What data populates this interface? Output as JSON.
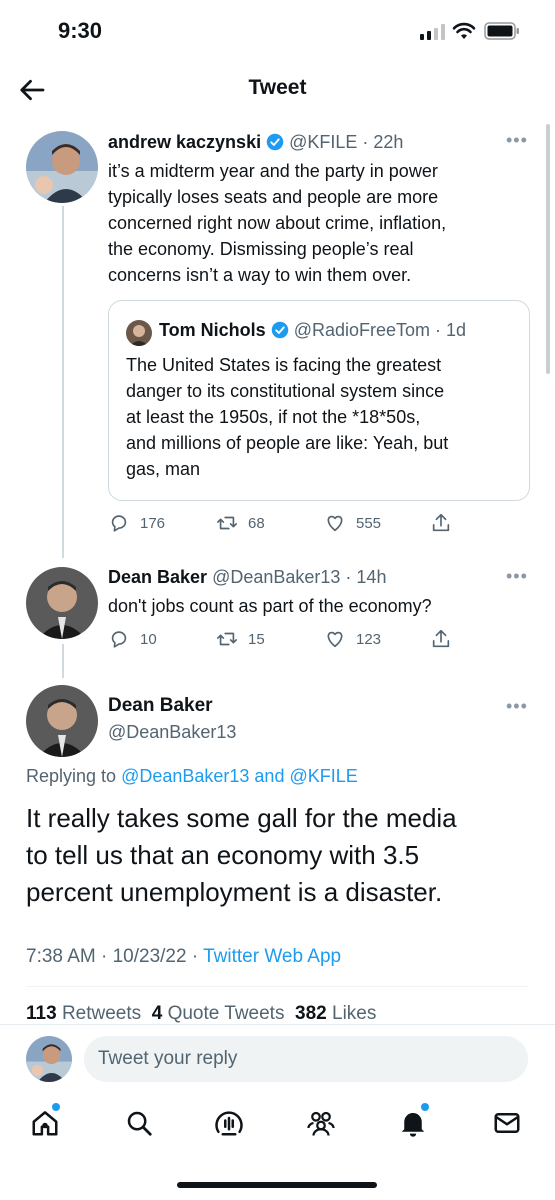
{
  "status_bar": {
    "time": "9:30"
  },
  "header": {
    "title": "Tweet"
  },
  "tweet1": {
    "name": "andrew kaczynski",
    "meta": "@KFILE · 22h",
    "lines": [
      "it’s a midterm year and the party in power",
      "typically loses seats and people are more",
      "concerned right now about crime, inflation,",
      "the economy. Dismissing people’s real",
      "concerns isn’t a way to win them over."
    ],
    "quote": {
      "name": "Tom Nichols",
      "meta": "@RadioFreeTom · 1d",
      "lines": [
        "The United States is facing the greatest",
        "danger to its constitutional system since",
        "at least the 1950s, if not the *18*50s,",
        "and millions of people are like: Yeah, but",
        "gas, man"
      ]
    },
    "replies": "176",
    "retweets": "68",
    "likes": "555"
  },
  "tweet2": {
    "name": "Dean Baker",
    "meta": "@DeanBaker13 · 14h",
    "text": "don't jobs count as part of the economy?",
    "replies": "10",
    "retweets": "15",
    "likes": "123"
  },
  "main": {
    "name": "Dean Baker",
    "handle": "@DeanBaker13",
    "replying_prefix": "Replying to",
    "replying_users": "@DeanBaker13 and @KFILE",
    "lines": [
      "It really takes some gall for the media",
      "to tell us that an economy with 3.5",
      "percent unemployment is a disaster."
    ],
    "timestamp": "7:38 AM · 10/23/22 ·",
    "source": "Twitter Web App",
    "retweets_count": "113",
    "retweets_label": "Retweets",
    "quotes_count": "4",
    "quotes_label": "Quote Tweets",
    "likes_count": "382",
    "likes_label": "Likes"
  },
  "compose": {
    "placeholder": "Tweet your reply"
  },
  "colors": {
    "accent": "#1d9bf0",
    "text": "#0f1419",
    "secondary": "#536471"
  },
  "icons": [
    "back-arrow-icon",
    "verified-icon",
    "more-icon",
    "reply-icon",
    "retweet-icon",
    "like-icon",
    "share-icon",
    "home-icon",
    "search-icon",
    "spaces-icon",
    "communities-icon",
    "notifications-icon",
    "messages-icon"
  ]
}
